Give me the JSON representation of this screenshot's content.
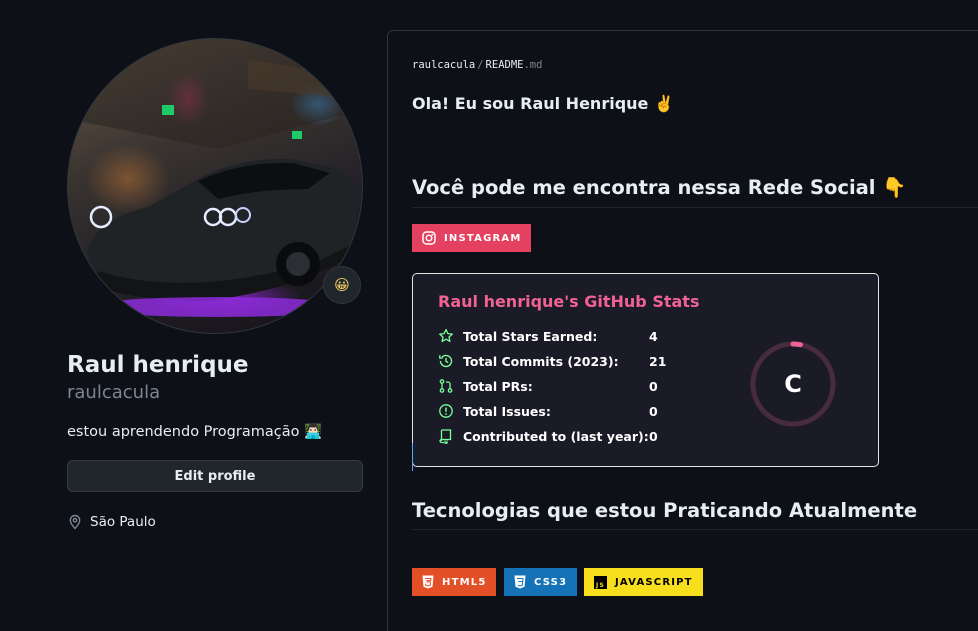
{
  "profile": {
    "status_emoji": "😀",
    "name": "Raul henrique",
    "login": "raulcacula",
    "bio": "estou aprendendo Programação 👨🏻‍💻",
    "edit_label": "Edit profile",
    "location": "São Paulo"
  },
  "readme": {
    "owner": "raulcacula",
    "separator": "/",
    "file_name": "README",
    "file_ext": ".md",
    "greeting": "Ola! Eu sou Raul Henrique ✌️",
    "social_heading": "Você pode me encontra nessa Rede Social 👇",
    "tech_heading": "Tecnologias que estou Praticando Atualmente",
    "social_badges": [
      {
        "label": "INSTAGRAM",
        "color": "#e4405f",
        "icon": "instagram-icon"
      }
    ],
    "tech_badges": [
      {
        "label": "HTML5",
        "color": "#e34f26",
        "icon": "html5-icon"
      },
      {
        "label": "CSS3",
        "color": "#1572b6",
        "icon": "css3-icon"
      },
      {
        "label": "JAVASCRIPT",
        "color": "#f7df1e",
        "text_color": "#000000",
        "icon": "javascript-icon"
      }
    ]
  },
  "stats": {
    "title": "Raul henrique's GitHub Stats",
    "rows": [
      {
        "label": "Total Stars Earned:",
        "value": "4",
        "icon": "star-icon"
      },
      {
        "label": "Total Commits (2023):",
        "value": "21",
        "icon": "history-icon"
      },
      {
        "label": "Total PRs:",
        "value": "0",
        "icon": "pull-request-icon"
      },
      {
        "label": "Total Issues:",
        "value": "0",
        "icon": "issue-icon"
      },
      {
        "label": "Contributed to (last year):",
        "value": "0",
        "icon": "repo-icon"
      }
    ],
    "rank": "C",
    "rank_progress": 0.03,
    "colors": {
      "title": "#f06292",
      "icon": "#79ff97",
      "ring": "#f06292",
      "background": "#1a1b27"
    }
  }
}
